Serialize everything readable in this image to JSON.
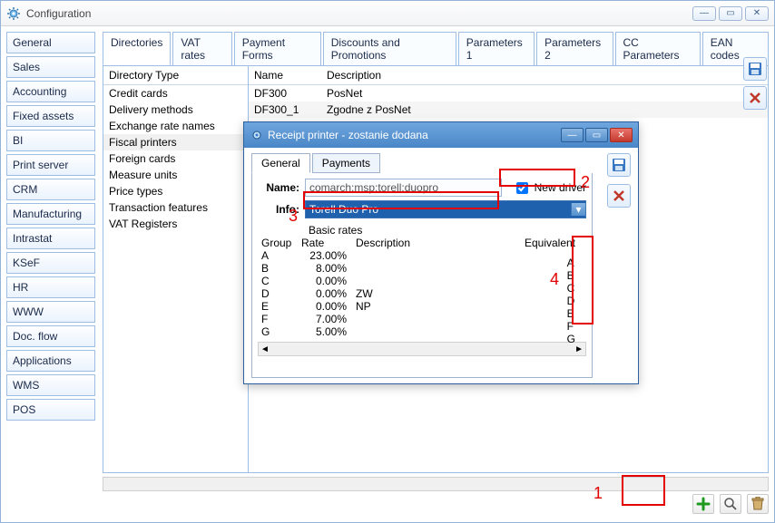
{
  "window": {
    "title": "Configuration"
  },
  "sidebar": [
    "General",
    "Sales",
    "Accounting",
    "Fixed assets",
    "BI",
    "Print server",
    "CRM",
    "Manufacturing",
    "Intrastat",
    "KSeF",
    "HR",
    "WWW",
    "Doc. flow",
    "Applications",
    "WMS",
    "POS"
  ],
  "tabs": [
    "Directories",
    "VAT rates",
    "Payment Forms",
    "Discounts and Promotions",
    "Parameters 1",
    "Parameters 2",
    "CC Parameters",
    "EAN codes"
  ],
  "active_tab": "Directories",
  "dir_types": {
    "header": "Directory Type",
    "items": [
      "Credit cards",
      "Delivery methods",
      "Exchange rate names",
      "Fiscal printers",
      "Foreign cards",
      "Measure units",
      "Price types",
      "Transaction features",
      "VAT Registers"
    ],
    "selected": "Fiscal printers"
  },
  "dir_table": {
    "cols": [
      "Name",
      "Description"
    ],
    "rows": [
      {
        "name": "DF300",
        "desc": "PosNet"
      },
      {
        "name": "DF300_1",
        "desc": "Zgodne z PosNet"
      }
    ]
  },
  "dialog": {
    "title": "Receipt printer - zostanie dodana",
    "tabs": [
      "General",
      "Payments"
    ],
    "active_tab": "General",
    "name_label": "Name:",
    "name_value": "comarch:msp:torell:duopro",
    "new_driver_label": "New driver",
    "new_driver_checked": true,
    "info_label": "Info:",
    "info_value": "Torell Duo Pro",
    "rates_title": "Basic rates",
    "rates_cols": [
      "Group",
      "Rate",
      "Description"
    ],
    "equiv_label": "Equivalent",
    "rates": [
      {
        "g": "A",
        "r": "23.00%",
        "d": ""
      },
      {
        "g": "B",
        "r": "8.00%",
        "d": ""
      },
      {
        "g": "C",
        "r": "0.00%",
        "d": ""
      },
      {
        "g": "D",
        "r": "0.00%",
        "d": "ZW"
      },
      {
        "g": "E",
        "r": "0.00%",
        "d": "NP"
      },
      {
        "g": "F",
        "r": "7.00%",
        "d": ""
      },
      {
        "g": "G",
        "r": "5.00%",
        "d": ""
      }
    ],
    "equiv": [
      "A",
      "B",
      "C",
      "D",
      "E",
      "F",
      "G"
    ]
  },
  "annotations": [
    "1",
    "2",
    "3",
    "4"
  ]
}
